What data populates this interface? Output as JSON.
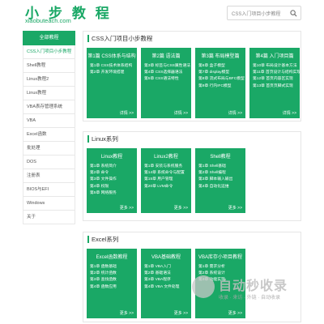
{
  "header": {
    "logo_title": "小 步 教 程",
    "logo_sub": "xiaobuteach.com",
    "search_placeholder": "CSS入门项目小步教程"
  },
  "sidebar": {
    "title": "全部教程",
    "items": [
      {
        "label": "CSS入门项目小步教程"
      },
      {
        "label": "Shell教程"
      },
      {
        "label": "Linux教程2"
      },
      {
        "label": "Linux教程"
      },
      {
        "label": "VBA表存管理系统"
      },
      {
        "label": "VBA"
      },
      {
        "label": "Excel函数"
      },
      {
        "label": "批处理"
      },
      {
        "label": "DOS"
      },
      {
        "label": "注册表"
      },
      {
        "label": "BIOS与EFI"
      },
      {
        "label": "Windows"
      },
      {
        "label": "关于"
      }
    ]
  },
  "sections": [
    {
      "title": "CSS入门项目小步教程",
      "cards": [
        {
          "title": "第1篇 CSS体系与结构",
          "items": [
            "第1章 CSS技术体系结构",
            "第2章 开发环境搭建"
          ],
          "more": "详情 >>"
        },
        {
          "title": "第2篇 语法篇",
          "items": [
            "第3章 标签与CSS属性语法",
            "第4章 CSS选择器语法",
            "第5章 CSS语法特性"
          ],
          "more": "详情 >>"
        },
        {
          "title": "第3篇 布局模型篇",
          "items": [
            "第6章 盒子模型",
            "第7章 display模型",
            "第8章 流式布局与BFC模型",
            "第9章 行内IFC模型"
          ],
          "more": "详情 >>"
        },
        {
          "title": "第4篇 入门项目篇",
          "items": [
            "第10章 布局设计基本方法",
            "第11章 首页设计与结构实现",
            "第12章 首页内容区实现",
            "第13章 首页页脚式实现"
          ],
          "more": "详情 >>"
        }
      ]
    },
    {
      "title": "Linux系列",
      "cards": [
        {
          "title": "Linux教程",
          "items": [
            "第1章 系统简介",
            "第2章 命令",
            "第3章 文件操作",
            "第4章 权限",
            "第5章 网络服务"
          ],
          "more": "更多 >>"
        },
        {
          "title": "Linux2教程",
          "items": [
            "第1章 安装与系统服务",
            "第14章 系统命令与配置",
            "第15章 用户管理",
            "第20章 LVM命令"
          ],
          "more": "更多 >>"
        },
        {
          "title": "Shell教程",
          "items": [
            "第1章 Shell基础",
            "第2章 Shell编程",
            "第3章 脚本输入输出",
            "第4章 自动化运维"
          ],
          "more": "更多 >>"
        }
      ]
    },
    {
      "title": "Excel系列",
      "cards": [
        {
          "title": "Excel函数教程",
          "items": [
            "第1章 函数基础",
            "第2章 统计函数",
            "第3章 查找函数",
            "第4章 函数应用"
          ],
          "more": "更多 >>"
        },
        {
          "title": "VBA基础教程",
          "items": [
            "第1章 VBA入门",
            "第2章 基础语法",
            "第3章 VBA程序",
            "第4章 VBA 文件处理"
          ],
          "more": "更多 >>"
        },
        {
          "title": "VBA库存小项目教程",
          "items": [
            "第1章 需求分析",
            "第2章 系统设计",
            "第3章 功能实现"
          ],
          "more": "更多 >>"
        }
      ]
    }
  ],
  "watermark": {
    "text": "自动秒收录",
    "sub": "收录 · 来访 · 外链 · 自动收录"
  }
}
